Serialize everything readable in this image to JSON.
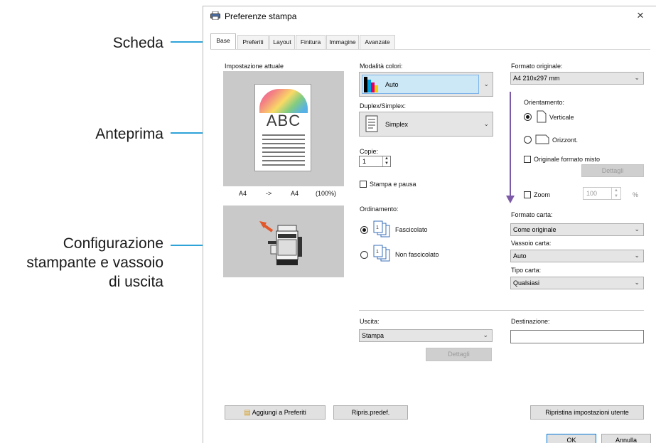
{
  "annotations": {
    "tab": "Scheda",
    "preview": "Anteprima",
    "printer_config_lines": [
      "Configurazione",
      "stampante e vassoio",
      "di uscita"
    ]
  },
  "window": {
    "title": "Preferenze stampa",
    "close": "×"
  },
  "tabs": [
    "Base",
    "Preferiti",
    "Layout",
    "Finitura",
    "Immagine",
    "Avanzate"
  ],
  "left": {
    "current_label": "Impostazione attuale",
    "preview_text": "ABC",
    "size_from": "A4",
    "size_arrow": "->",
    "size_to": "A4",
    "size_pct": "(100%)"
  },
  "middle": {
    "color_mode_label": "Modalità colori:",
    "color_mode_value": "Auto",
    "duplex_label": "Duplex/Simplex:",
    "duplex_value": "Simplex",
    "copies_label": "Copie:",
    "copies_value": "1",
    "print_pause": "Stampa e pausa",
    "collation_label": "Ordinamento:",
    "collated": "Fascicolato",
    "uncollated": "Non fascicolato"
  },
  "right": {
    "orig_format_label": "Formato originale:",
    "orig_format_value": "A4 210x297 mm",
    "orientation_label": "Orientamento:",
    "portrait": "Verticale",
    "landscape": "Orizzont.",
    "mixed": "Originale formato misto",
    "details": "Dettagli",
    "zoom": "Zoom",
    "zoom_value": "100",
    "zoom_unit": "%",
    "paper_format_label": "Formato carta:",
    "paper_format_value": "Come originale",
    "tray_label": "Vassoio carta:",
    "tray_value": "Auto",
    "paper_type_label": "Tipo carta:",
    "paper_type_value": "Qualsiasi"
  },
  "output": {
    "label": "Uscita:",
    "value": "Stampa",
    "details": "Dettagli",
    "dest_label": "Destinazione:",
    "dest_value": ""
  },
  "footer": {
    "add_fav": "Aggiungi a Preferiti",
    "restore_default": "Ripris.predef.",
    "restore_user": "Ripristina impostazioni utente",
    "ok": "OK",
    "cancel": "Annulla"
  },
  "colors": {
    "callout": "#2ea3d8",
    "selected_combo": "#cce8f7"
  }
}
